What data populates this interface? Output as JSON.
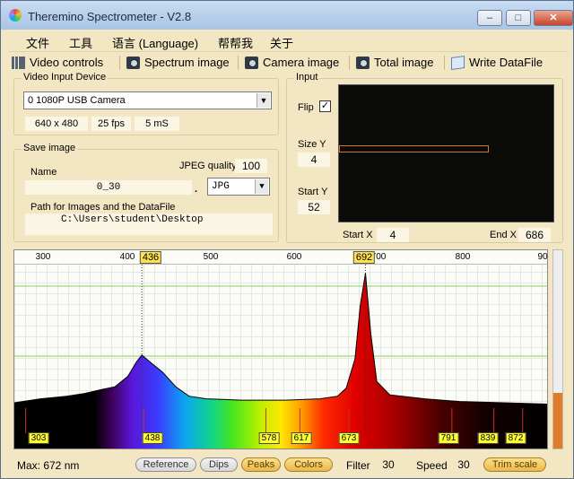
{
  "window": {
    "title": "Theremino Spectrometer - V2.8"
  },
  "menu": [
    "文件",
    "工具",
    "语言 (Language)",
    "帮帮我",
    "关于"
  ],
  "toolbar": [
    "Video controls",
    "Spectrum image",
    "Camera image",
    "Total image",
    "Write DataFile"
  ],
  "video_input": {
    "title": "Video Input Device",
    "device": "0 1080P USB Camera",
    "resolution": "640 x 480",
    "fps": "25 fps",
    "exposure": "5 mS"
  },
  "save_image": {
    "title": "Save image",
    "name_label": "Name",
    "name_value": "0_30",
    "dot": ".",
    "jpeg_quality_label": "JPEG quality",
    "jpeg_quality_value": "100",
    "format": "JPG",
    "path_label": "Path for Images and the DataFile",
    "path_value": "C:\\Users\\student\\Desktop"
  },
  "input": {
    "title": "Input",
    "flip_label": "Flip",
    "flip_checked": "✓",
    "size_y_label": "Size Y",
    "size_y_value": "4",
    "start_y_label": "Start Y",
    "start_y_value": "52",
    "start_x_label": "Start X",
    "start_x_value": "4",
    "end_x_label": "End X",
    "end_x_value": "686"
  },
  "spectrum": {
    "scale_ticks": [
      "300",
      "400",
      "500",
      "600",
      "700",
      "800",
      "90"
    ],
    "top_markers": [
      "436",
      "692"
    ],
    "peak_labels": [
      "303",
      "438",
      "578",
      "617",
      "673",
      "791",
      "839",
      "872"
    ],
    "curve_color": "#000000",
    "gridline_color": "#99cc66"
  },
  "status": {
    "max_text": "Max: 672 nm",
    "reference_label": "Reference",
    "dips_label": "Dips",
    "peaks_label": "Peaks",
    "colors_label": "Colors",
    "filter_label": "Filter",
    "filter_value": "30",
    "speed_label": "Speed",
    "speed_value": "30",
    "trim_label": "Trim scale"
  },
  "chart_data": {
    "type": "line",
    "x": [
      290,
      320,
      350,
      370,
      390,
      405,
      420,
      430,
      436,
      445,
      460,
      475,
      490,
      510,
      550,
      600,
      640,
      660,
      670,
      680,
      686,
      692,
      698,
      705,
      720,
      760,
      800,
      850,
      900
    ],
    "values": [
      0.02,
      0.05,
      0.07,
      0.09,
      0.12,
      0.14,
      0.22,
      0.33,
      0.38,
      0.33,
      0.25,
      0.14,
      0.07,
      0.05,
      0.04,
      0.04,
      0.05,
      0.07,
      0.13,
      0.35,
      0.75,
      1.0,
      0.55,
      0.18,
      0.08,
      0.05,
      0.03,
      0.02,
      0.01
    ],
    "xlim": [
      290,
      900
    ],
    "ylim": [
      0,
      1.05
    ]
  }
}
